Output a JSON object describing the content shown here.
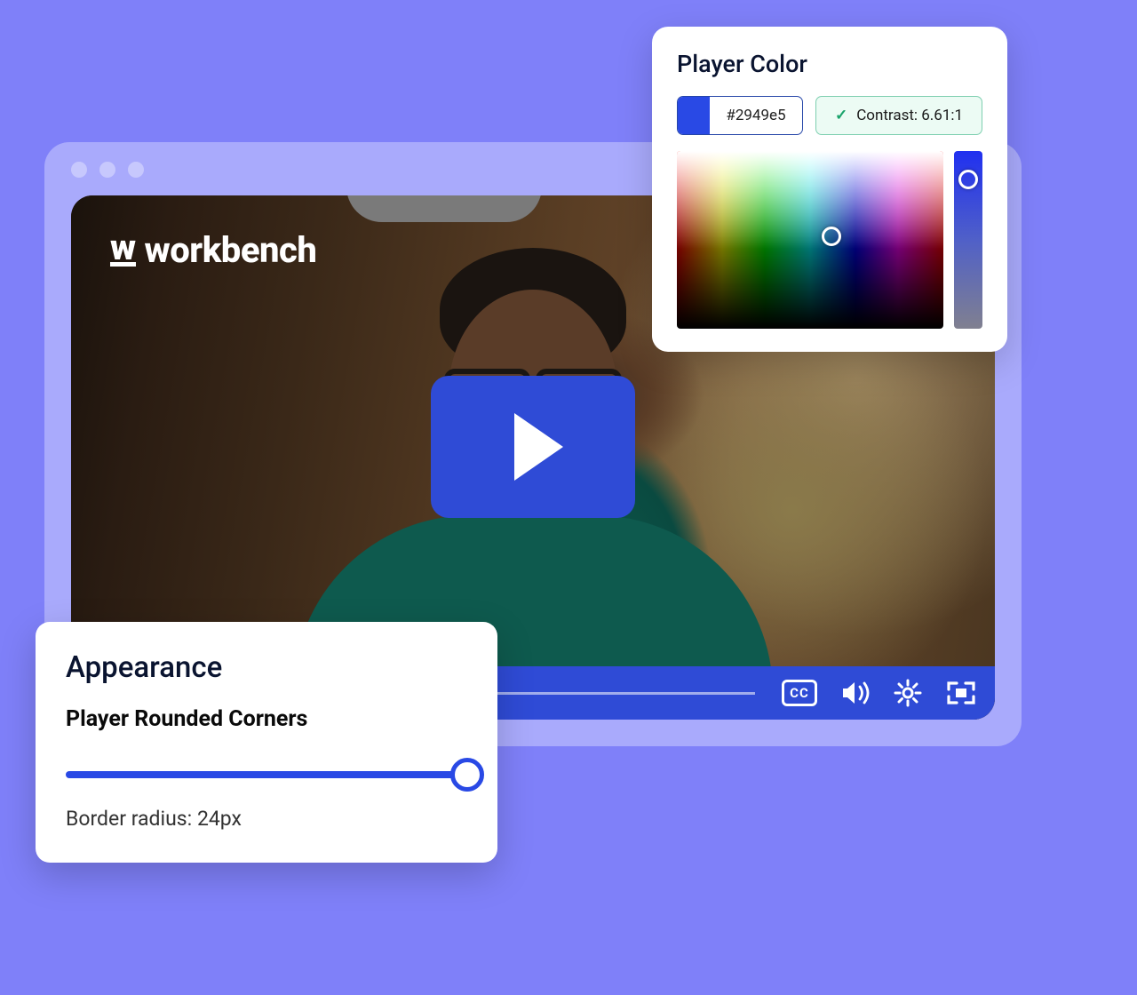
{
  "watermark": {
    "text": "workbench",
    "icon_char": "w"
  },
  "player": {
    "accent_color": "#2949e5",
    "border_radius_px": 24
  },
  "color_panel": {
    "title": "Player Color",
    "hex_value": "#2949e5",
    "contrast_label": "Contrast: 6.61:1"
  },
  "appearance_panel": {
    "title": "Appearance",
    "subheading": "Player Rounded Corners",
    "radius_label": "Border radius: 24px"
  },
  "controls": {
    "cc": "CC"
  }
}
